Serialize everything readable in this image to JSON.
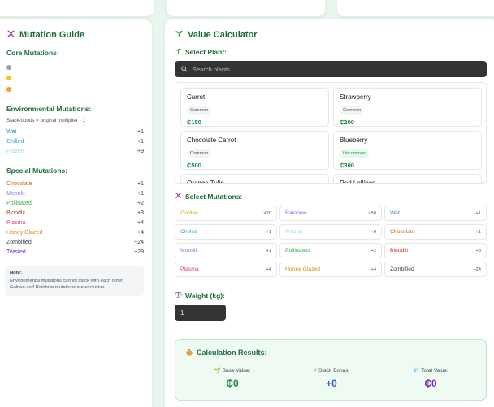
{
  "colors": {
    "accent": "#1f6b3a",
    "price": "#1f8a45",
    "input_bg": "#343434",
    "stack_blue": "#3b5bdb",
    "total_purple": "#7b2cbf",
    "base_green": "#1f8a45"
  },
  "guide": {
    "title": "Mutation Guide",
    "icon": "dna-icon",
    "core_heading": "Core Mutations:",
    "core_dots": [
      {
        "color": "#9aa0a6"
      },
      {
        "color": "#f5c518"
      },
      {
        "color": "#f59f1a"
      }
    ],
    "env_heading": "Environmental Mutations:",
    "env_note": "Stack-bonus = original multiplier - 1",
    "env_items": [
      {
        "name": "Wet",
        "value": "+1",
        "color": "#3b82c4"
      },
      {
        "name": "Chilled",
        "value": "+1",
        "color": "#3aa7c9"
      },
      {
        "name": "Frozen",
        "value": "+9",
        "color": "#9fd3ea"
      }
    ],
    "special_heading": "Special Mutations:",
    "special_items": [
      {
        "name": "Chocolate",
        "value": "+1",
        "color": "#c2691f"
      },
      {
        "name": "Moonlit",
        "value": "+1",
        "color": "#8b7fd6"
      },
      {
        "name": "Pollinated",
        "value": "+2",
        "color": "#3aa84a"
      },
      {
        "name": "Bloodlit",
        "value": "+3",
        "color": "#c0392b"
      },
      {
        "name": "Plasma",
        "value": "+4",
        "color": "#e0407a"
      },
      {
        "name": "Honey Glazed",
        "value": "+4",
        "color": "#d98b1e"
      },
      {
        "name": "Zombified",
        "value": "+24",
        "color": "#374151"
      },
      {
        "name": "Twisted",
        "value": "+29",
        "color": "#7b2cbf"
      }
    ],
    "note_title": "Note:",
    "note_text": "Environmental mutations cannot stack with each other. Golden and Rainbow mutations are exclusive."
  },
  "calculator": {
    "title": "Value Calculator",
    "icon": "sprout-icon",
    "select_plant_label": "Select Plant:",
    "search_placeholder": "Search plants...",
    "plants": [
      {
        "name": "Carrot",
        "rarity": "Common",
        "price": "₵150",
        "uncommon": false
      },
      {
        "name": "Strawberry",
        "rarity": "Common",
        "price": "₵200",
        "uncommon": false
      },
      {
        "name": "Chocolate Carrot",
        "rarity": "Common",
        "price": "₵500",
        "uncommon": false
      },
      {
        "name": "Blueberry",
        "rarity": "Uncommon",
        "price": "₵300",
        "uncommon": true
      },
      {
        "name": "Orange Tulip",
        "rarity": "",
        "price": "",
        "uncommon": false
      },
      {
        "name": "Red Lollipop",
        "rarity": "",
        "price": "",
        "uncommon": false
      }
    ],
    "select_mutations_label": "Select Mutations:",
    "mutations": [
      {
        "name": "Golden",
        "bonus": "×20",
        "color": "#e0a11b"
      },
      {
        "name": "Rainbow",
        "bonus": "×50",
        "color": "#8b5cf6"
      },
      {
        "name": "Wet",
        "bonus": "+1",
        "color": "#3b82c4"
      },
      {
        "name": "Chilled",
        "bonus": "+1",
        "color": "#3aa7c9"
      },
      {
        "name": "Frozen",
        "bonus": "+9",
        "color": "#9fd3ea"
      },
      {
        "name": "Chocolate",
        "bonus": "+1",
        "color": "#c2691f"
      },
      {
        "name": "Moonlit",
        "bonus": "+1",
        "color": "#8b7fd6"
      },
      {
        "name": "Pollinated",
        "bonus": "+2",
        "color": "#3aa84a"
      },
      {
        "name": "Bloodlit",
        "bonus": "+3",
        "color": "#c0392b"
      },
      {
        "name": "Plasma",
        "bonus": "+4",
        "color": "#e0407a"
      },
      {
        "name": "Honey Glazed",
        "bonus": "+4",
        "color": "#d98b1e"
      },
      {
        "name": "Zombified",
        "bonus": "+24",
        "color": "#374151"
      }
    ],
    "weight_label": "Weight (kg):",
    "weight_value": "1",
    "results_title": "Calculation Results:",
    "base_label": "Base Value:",
    "base_value": "₵0",
    "stack_label": "Stack Bonus:",
    "stack_value": "+0",
    "total_label": "Total Value:",
    "total_value": "₵0"
  }
}
